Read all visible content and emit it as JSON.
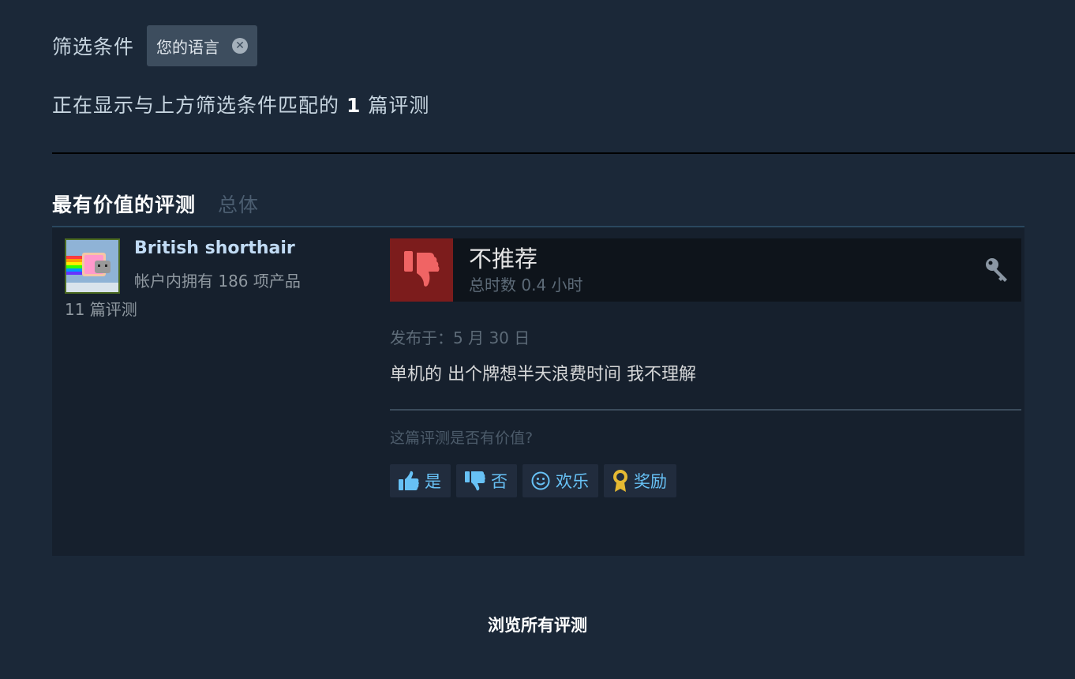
{
  "filter": {
    "label": "筛选条件",
    "chip_label": "您的语言",
    "chip_remove_icon": "close-circle-icon"
  },
  "summary": {
    "prefix": "正在显示与上方筛选条件匹配的",
    "count": "1",
    "suffix": "篇评测"
  },
  "section": {
    "title": "最有价值的评测",
    "subtitle": "总体"
  },
  "review": {
    "author": {
      "name": "British shorthair",
      "products_owned": "帐户内拥有 186 项产品",
      "reviews_count": "11 篇评测",
      "avatar_icon": "nyan-cat-avatar"
    },
    "verdict": "不推荐",
    "verdict_icon": "thumbs-down-icon",
    "hours": "总时数 0.4 小时",
    "key_icon": "key-icon",
    "posted": "发布于：5 月 30 日",
    "body": "单机的 出个牌想半天浪费时间 我不理解",
    "helpful_question": "这篇评测是否有价值?",
    "buttons": [
      {
        "label": "是",
        "icon": "thumbs-up-icon"
      },
      {
        "label": "否",
        "icon": "thumbs-down-icon"
      },
      {
        "label": "欢乐",
        "icon": "smiley-icon"
      },
      {
        "label": "奖励",
        "icon": "award-icon"
      }
    ]
  },
  "footer": {
    "browse_all": "浏览所有评测"
  },
  "colors": {
    "background": "#1b2838",
    "card": "#16202d",
    "link_blue": "#67c1f5",
    "thumb_down_bg": "#7c1c1c",
    "award_gold": "#e5b932"
  }
}
